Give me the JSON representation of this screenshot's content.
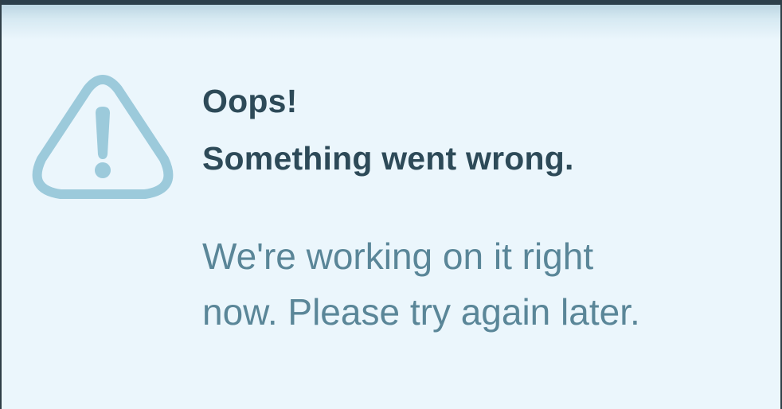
{
  "error": {
    "icon": "warning-triangle-icon",
    "title_line1": "Oops!",
    "title_line2": "Something went wrong.",
    "message_line1": "We're working on it right",
    "message_line2": "now. Please try again later."
  },
  "colors": {
    "background": "#ebf6fc",
    "title": "#2d4a58",
    "message": "#5a8698",
    "icon": "#9ccadb",
    "top_bar": "#2c3f4a"
  }
}
